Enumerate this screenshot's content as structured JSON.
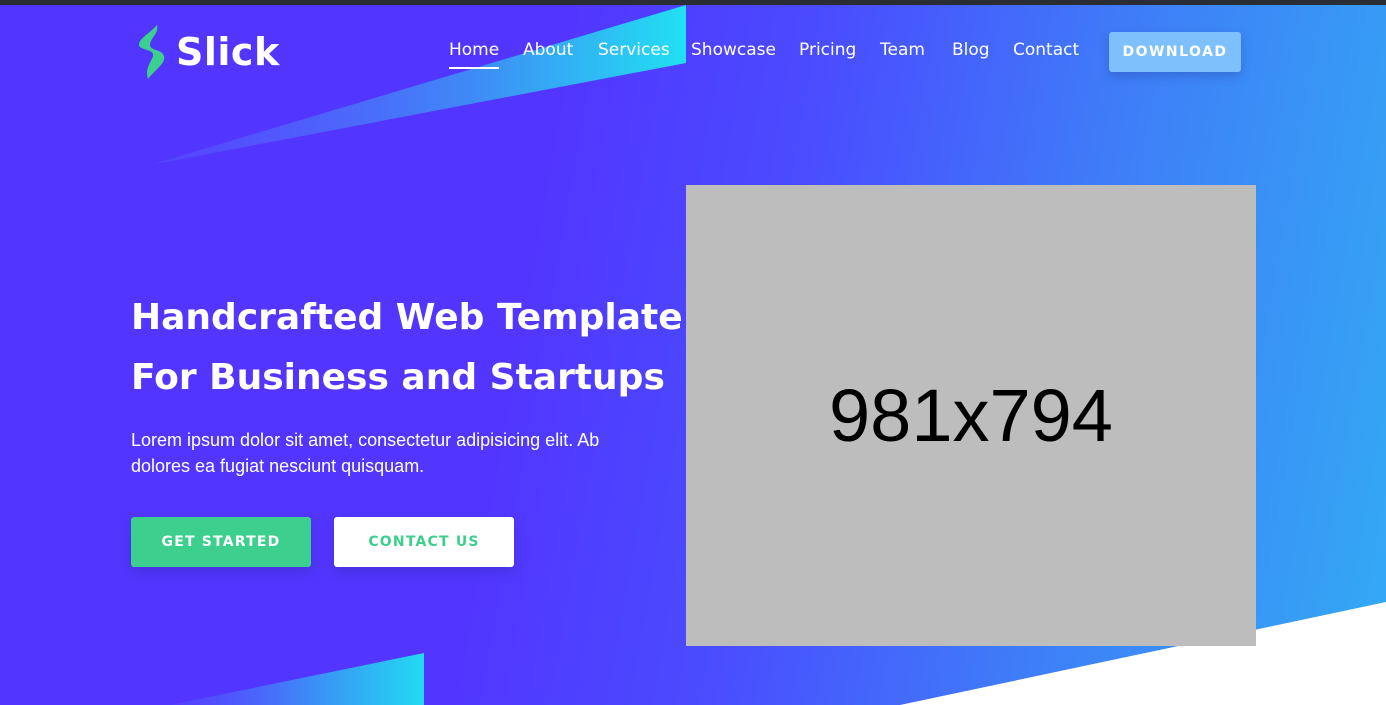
{
  "brand": {
    "name": "Slick",
    "logo_icon": "bolt-icon",
    "logo_color": "#3ccf8e"
  },
  "nav": {
    "items": [
      {
        "label": "Home",
        "active": true
      },
      {
        "label": "About"
      },
      {
        "label": "Services"
      },
      {
        "label": "Showcase"
      },
      {
        "label": "Pricing"
      },
      {
        "label": "Team"
      },
      {
        "label": "Blog"
      },
      {
        "label": "Contact"
      }
    ],
    "download_label": "DOWNLOAD"
  },
  "hero": {
    "title_line1": "Handcrafted Web Template",
    "title_line2": "For Business and Startups",
    "subtitle": "Lorem ipsum dolor sit amet, consectetur adipisicing elit. Ab dolores ea fugiat nesciunt quisquam.",
    "primary_button": "GET STARTED",
    "secondary_button": "CONTACT US",
    "image_placeholder": "981x794"
  },
  "colors": {
    "accent": "#3ccf8e",
    "gradient_start": "#5236ff",
    "gradient_end": "#33aaf4",
    "download_button": "#7ec0fb",
    "placeholder_bg": "#bdbdbd"
  }
}
